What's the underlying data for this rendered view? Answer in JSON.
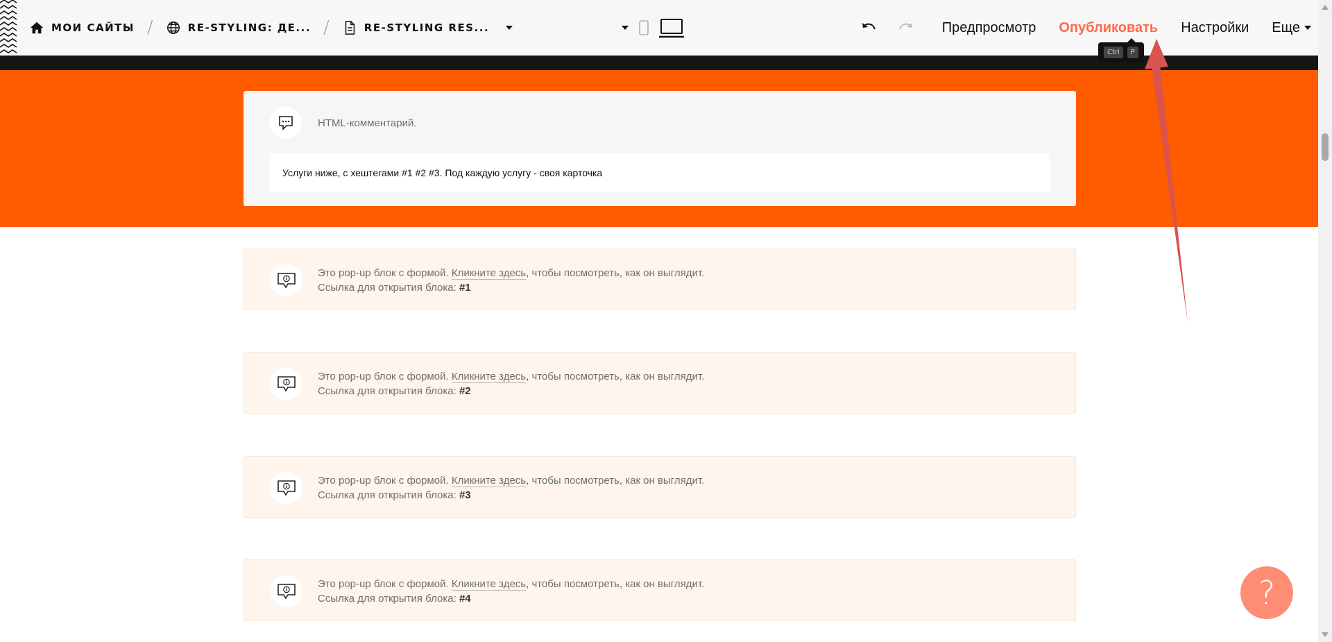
{
  "topbar": {
    "breadcrumbs": [
      {
        "label": "МОИ САЙТЫ",
        "icon": "home-icon"
      },
      {
        "label": "RE-STYLING: ДЕ...",
        "icon": "globe-icon"
      },
      {
        "label": "RE-STYLING RES...",
        "icon": "page-icon"
      }
    ],
    "separator": "/",
    "actions": {
      "preview": "Предпросмотр",
      "publish": "Опубликовать",
      "settings": "Настройки",
      "more": "Еще"
    },
    "shortcut": {
      "ctrl": "Ctrl",
      "key": "P"
    },
    "publish_color": "#ff6a4a"
  },
  "comment_block": {
    "title": "HTML-комментарий.",
    "text": "Услуги ниже, с хештегами #1 #2 #3. Под каждую услугу - своя карточка"
  },
  "popups": [
    {
      "line1_pre": "Это pop-up блок с формой.",
      "link": "Кликните здесь",
      "line1_post": ", чтобы посмотреть, как он выглядит.",
      "line2": "Ссылка для открытия блока:",
      "hash": "#1"
    },
    {
      "line1_pre": "Это pop-up блок с формой.",
      "link": "Кликните здесь",
      "line1_post": ", чтобы посмотреть, как он выглядит.",
      "line2": "Ссылка для открытия блока:",
      "hash": "#2"
    },
    {
      "line1_pre": "Это pop-up блок с формой.",
      "link": "Кликните здесь",
      "line1_post": ", чтобы посмотреть, как он выглядит.",
      "line2": "Ссылка для открытия блока:",
      "hash": "#3"
    },
    {
      "line1_pre": "Это pop-up блок с формой.",
      "link": "Кликните здесь",
      "line1_post": ", чтобы посмотреть, как он выглядит.",
      "line2": "Ссылка для открытия блока:",
      "hash": "#4"
    }
  ],
  "help_button": "?",
  "colors": {
    "orange_band": "#ff5c00",
    "popup_bg": "#fff5ec",
    "help_bg": "#ff8d74",
    "annotation_arrow": "#d9534f"
  }
}
